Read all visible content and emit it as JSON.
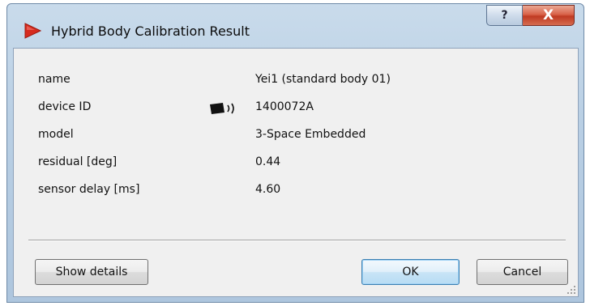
{
  "window": {
    "title": "Hybrid Body Calibration Result",
    "help_glyph": "?",
    "close_glyph": "X"
  },
  "fields": [
    {
      "label": "name",
      "value": "Yei1 (standard body 01)"
    },
    {
      "label": "device ID",
      "value": "1400072A",
      "icon": "wireless-device-icon"
    },
    {
      "label": "model",
      "value": "3-Space Embedded"
    },
    {
      "label": "residual [deg]",
      "value": "0.44"
    },
    {
      "label": "sensor delay [ms]",
      "value": "4.60"
    }
  ],
  "buttons": {
    "show_details": "Show details",
    "ok": "OK",
    "cancel": "Cancel"
  },
  "colors": {
    "app_icon": "#d62b1e",
    "close_button": "#c8452b",
    "ok_border": "#3c7fb1"
  }
}
